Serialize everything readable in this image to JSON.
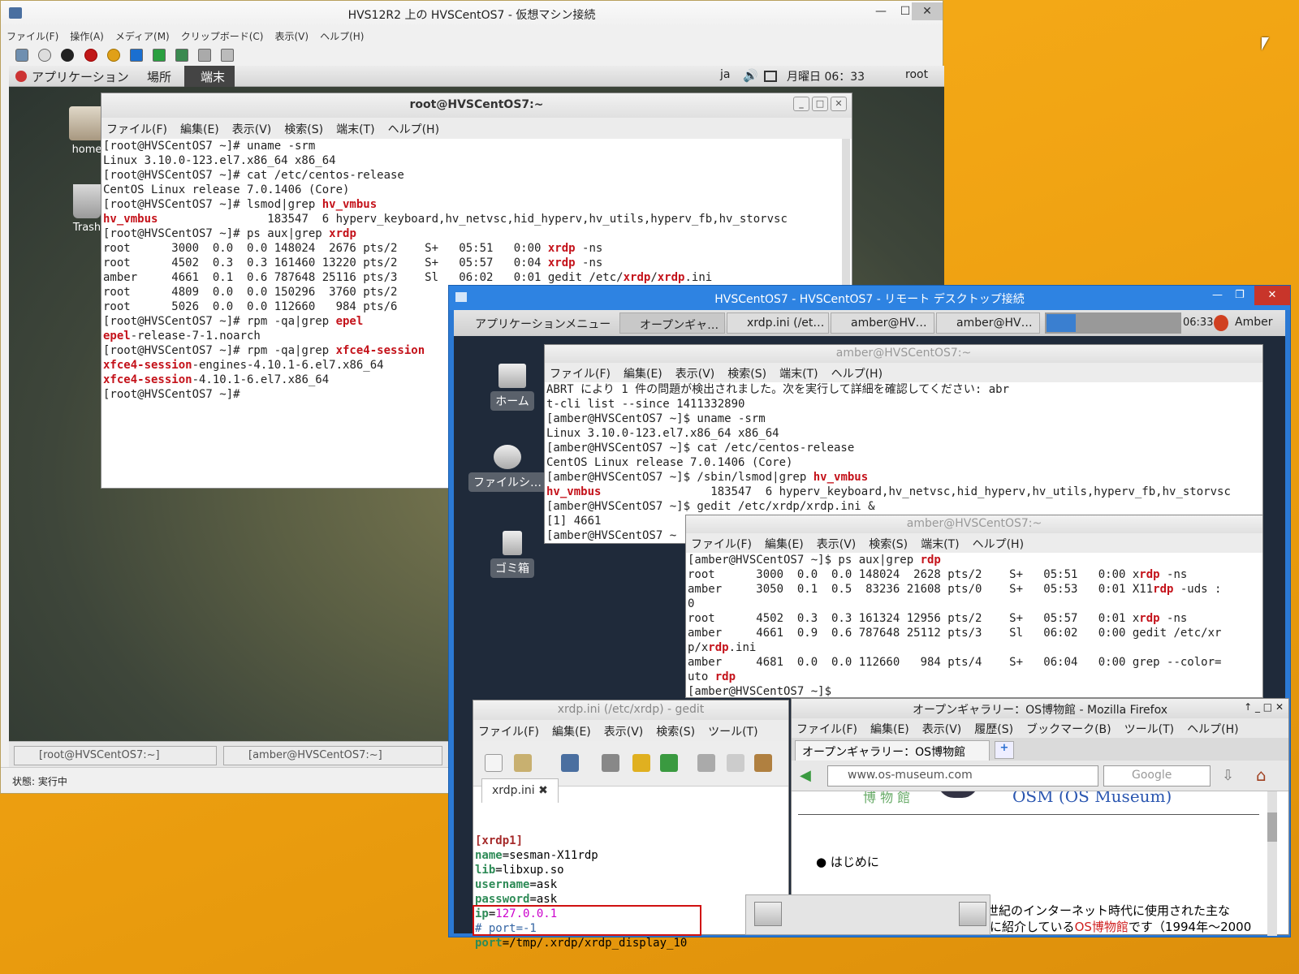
{
  "host": {
    "title": "HVS12R2 上の HVSCentOS7 - 仮想マシン接続",
    "menu": [
      "ファイル(F)",
      "操作(A)",
      "メディア(M)",
      "クリップボード(C)",
      "表示(V)",
      "ヘルプ(H)"
    ],
    "status": "状態: 実行中"
  },
  "gnome": {
    "apps": "アプリケーション",
    "places": "場所",
    "terminal": "端末",
    "lang": "ja",
    "clock": "月曜日 06：33",
    "user": "root",
    "icons": [
      "home",
      "Trash"
    ],
    "tasks": [
      "[root@HVSCentOS7:~]",
      "[amber@HVSCentOS7:~]"
    ]
  },
  "rootterm": {
    "title": "root@HVSCentOS7:~",
    "menu": [
      "ファイル(F)",
      "編集(E)",
      "表示(V)",
      "検索(S)",
      "端末(T)",
      "ヘルプ(H)"
    ],
    "lines": [
      "[root@HVSCentOS7 ~]# uname -srm",
      "Linux 3.10.0-123.el7.x86_64 x86_64",
      "[root@HVSCentOS7 ~]# cat /etc/centos-release",
      "CentOS Linux release 7.0.1406 (Core)",
      "[root@HVSCentOS7 ~]# lsmod|grep hv_vmbus",
      "hv_vmbus                183547  6 hyperv_keyboard,hv_netvsc,hid_hyperv,hv_utils,hyperv_fb,hv_storvsc",
      "[root@HVSCentOS7 ~]# ps aux|grep xrdp",
      "root      3000  0.0  0.0 148024  2676 pts/2    S+   05:51   0:00 xrdp -ns",
      "root      4502  0.3  0.3 161460 13220 pts/2    S+   05:57   0:04 xrdp -ns",
      "amber     4661  0.1  0.6 787648 25116 pts/3    Sl   06:02   0:01 gedit /etc/xrdp/xrdp.ini",
      "root      4809  0.0  0.0 150296  3760 pts/2",
      "root      5026  0.0  0.0 112660   984 pts/6",
      "[root@HVSCentOS7 ~]# rpm -qa|grep epel",
      "epel-release-7-1.noarch",
      "[root@HVSCentOS7 ~]# rpm -qa|grep xfce4-session",
      "xfce4-session-engines-4.10.1-6.el7.x86_64",
      "xfce4-session-4.10.1-6.el7.x86_64",
      "[root@HVSCentOS7 ~]# "
    ]
  },
  "rdp": {
    "title": "HVSCentOS7 - HVSCentOS7 - リモート デスクトップ接続",
    "appmenu": "アプリケーションメニュー",
    "tasks": [
      "オープンギャ…",
      "xrdp.ini (/et…",
      "amber@HV…",
      "amber@HV…"
    ],
    "clock": "06:33",
    "user": "Amber",
    "icons": [
      "ホーム",
      "ファイルシ…",
      "ゴミ箱"
    ]
  },
  "amber1": {
    "title": "amber@HVSCentOS7:~",
    "menu": [
      "ファイル(F)",
      "編集(E)",
      "表示(V)",
      "検索(S)",
      "端末(T)",
      "ヘルプ(H)"
    ],
    "lines": [
      "ABRT により 1 件の問題が検出されました。次を実行して詳細を確認してください: abr",
      "t-cli list --since 1411332890",
      "[amber@HVSCentOS7 ~]$ uname -srm",
      "Linux 3.10.0-123.el7.x86_64 x86_64",
      "[amber@HVSCentOS7 ~]$ cat /etc/centos-release",
      "CentOS Linux release 7.0.1406 (Core)",
      "[amber@HVSCentOS7 ~]$ /sbin/lsmod|grep hv_vmbus",
      "hv_vmbus                183547  6 hyperv_keyboard,hv_netvsc,hid_hyperv,hv_utils,hyperv_fb,hv_storvsc",
      "[amber@HVSCentOS7 ~]$ gedit /etc/xrdp/xrdp.ini &",
      "[1] 4661",
      "[amber@HVSCentOS7 ~"
    ]
  },
  "amber2": {
    "title": "amber@HVSCentOS7:~",
    "menu": [
      "ファイル(F)",
      "編集(E)",
      "表示(V)",
      "検索(S)",
      "端末(T)",
      "ヘルプ(H)"
    ],
    "lines": [
      "[amber@HVSCentOS7 ~]$ ps aux|grep rdp",
      "root      3000  0.0  0.0 148024  2628 pts/2    S+   05:51   0:00 xrdp -ns",
      "amber     3050  0.1  0.5  83236 21608 pts/0    S+   05:53   0:01 X11rdp -uds :",
      "0",
      "root      4502  0.3  0.3 161324 12956 pts/2    S+   05:57   0:01 xrdp -ns",
      "amber     4661  0.9  0.6 787648 25112 pts/3    Sl   06:02   0:00 gedit /etc/xr",
      "p/xrdp.ini",
      "amber     4681  0.0  0.0 112660   984 pts/4    S+   06:04   0:00 grep --color=",
      "uto rdp",
      "[amber@HVSCentOS7 ~]$ "
    ]
  },
  "gedit": {
    "title": "xrdp.ini (/etc/xrdp) - gedit",
    "menu": [
      "ファイル(F)",
      "編集(E)",
      "表示(V)",
      "検索(S)",
      "ツール(T)"
    ],
    "tab": "xrdp.ini",
    "lines": {
      "section": "[xrdp1]",
      "name": [
        "name",
        "sesman-X11rdp"
      ],
      "lib": [
        "lib",
        "libxup.so"
      ],
      "username": [
        "username",
        "ask"
      ],
      "password": [
        "password",
        "ask"
      ],
      "ip": [
        "ip",
        "127.0.0.1"
      ],
      "comment": "# port=-1",
      "port": [
        "port",
        "/tmp/.xrdp/xrdp_display_10"
      ]
    }
  },
  "firefox": {
    "title": "オープンギャラリー：OS博物館 - Mozilla Firefox",
    "menu": [
      "ファイル(F)",
      "編集(E)",
      "表示(V)",
      "履歴(S)",
      "ブックマーク(B)",
      "ツール(T)",
      "ヘルプ(H)"
    ],
    "tab": "オープンギャラリー：OS博物館",
    "url": "www.os-museum.com",
    "search": "Google",
    "heading": "OSM (OS Museum)",
    "bullet": "はじめに",
    "text1": "世紀のインターネット時代に使用された主な",
    "text2a": "に紹介している",
    "text2b": "OS博物館",
    "text2c": "です（1994年～2000",
    "logo": "博 物 館"
  },
  "colors": {
    "highlight": "#c4121a",
    "rdpblue": "#2e83e2",
    "desk": "#1f2a3a"
  }
}
